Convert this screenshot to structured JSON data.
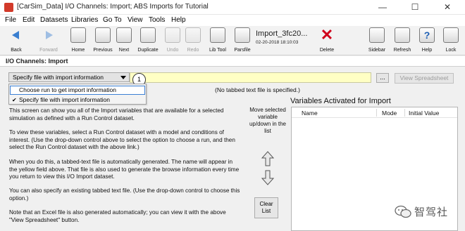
{
  "window": {
    "title": "[CarSim_Data] I/O Channels: Import; ABS Imports for Tutorial",
    "controls": [
      "—",
      "☐",
      "✕"
    ]
  },
  "menu": [
    "File",
    "Edit",
    "Datasets",
    "Libraries",
    "Go To",
    "View",
    "Tools",
    "Help"
  ],
  "toolbar": {
    "back": "Back",
    "forward": "Forward",
    "home": "Home",
    "previous": "Previous",
    "next": "Next",
    "duplicate": "Duplicate",
    "undo": "Undo",
    "redo": "Redo",
    "lib_tool": "Lib Tool",
    "parsfile": "Parsfile",
    "dataset_name": "Import_3fc20...",
    "dataset_date": "02-20-2018 18:10:03",
    "delete": "Delete",
    "sidebar": "Sidebar",
    "refresh": "Refresh",
    "help": "Help",
    "lock": "Lock"
  },
  "panel_title": "I/O Channels: Import",
  "dropdown": {
    "label": "Specify file with import information",
    "options": [
      "Choose run to get import information",
      "Specify file with import information"
    ],
    "checked_index": 1,
    "highlighted_index": 0
  },
  "callout_number": "1",
  "dots_label": "...",
  "view_spreadsheet": "View Spreadsheet",
  "no_file_note": "(No tabbed text file is specified.)",
  "description": [
    "This screen can show you all of the Import  variables that are available for  a selected simulation as defined with a Run Control dataset.",
    "To view these variables, select a Run Control dataset with a model and conditions of interest. (Use the drop-down control above to select the option to choose a run, and then select the Run Control dataset with the above link.)",
    "When you do this, a tabbed-text file is automatically generated. The name will appear in the yellow field above. That file is also used to generate the browse information every time you return to view this I/O Import dataset.",
    "You can also specify an existing tabbed text file. (Use the drop-down control to choose this option.)",
    "Note that an Excel file is also generated automatically; you can view it with the above \"View Spreadsheet\" button."
  ],
  "move_text": "Move selected variable up/down in the list",
  "clear_list": "Clear List",
  "variables": {
    "title": "Variables Activated for Import",
    "columns": [
      "Name",
      "Mode",
      "Initial Value"
    ]
  },
  "watermark": "智驾社",
  "colors": {
    "yellow_field": "#ffffc4",
    "highlight_border": "#3b7fd4",
    "delete_red": "#d0021b"
  }
}
